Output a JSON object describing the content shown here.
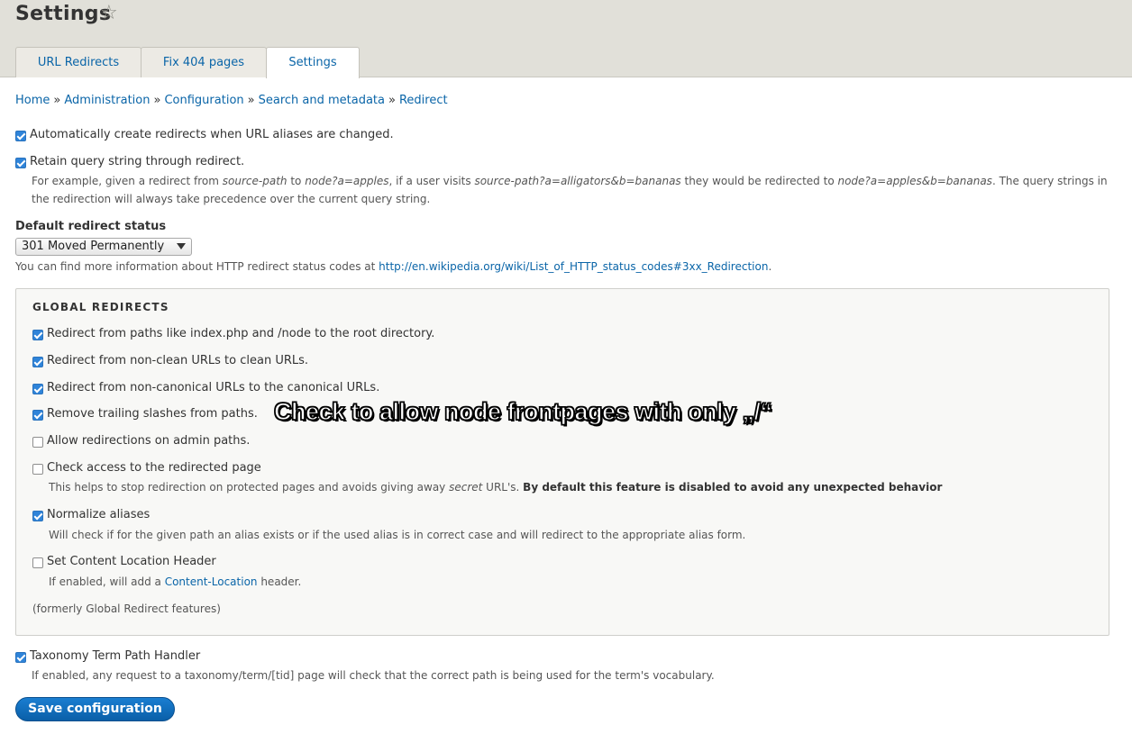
{
  "header": {
    "title": "Settings",
    "star_icon": "☆",
    "tabs": [
      {
        "label": "URL Redirects"
      },
      {
        "label": "Fix 404 pages"
      },
      {
        "label": "Settings"
      }
    ]
  },
  "breadcrumb": {
    "items": [
      "Home",
      "Administration",
      "Configuration",
      "Search and metadata",
      "Redirect"
    ],
    "separator": "»"
  },
  "options": {
    "auto_redirect": {
      "label": "Automatically create redirects when URL aliases are changed.",
      "checked": true
    },
    "retain_query": {
      "label": "Retain query string through redirect.",
      "checked": true,
      "desc": {
        "t1": "For example, given a redirect from ",
        "i1": "source-path",
        "t2": " to ",
        "i2": "node?a=apples",
        "t3": ", if a user visits ",
        "i3": "source-path?a=alligators&b=bananas",
        "t4": " they would be redirected to ",
        "i4": "node?a=apples&b=bananas",
        "t5": ". The query strings in",
        "line2": "the redirection will always take precedence over the current query string."
      }
    }
  },
  "status": {
    "label": "Default redirect status",
    "selected": "301 Moved Permanently",
    "help_prefix": "You can find more information about HTTP redirect status codes at ",
    "help_link": "http://en.wikipedia.org/wiki/List_of_HTTP_status_codes#3xx_Redirection",
    "help_suffix": "."
  },
  "global": {
    "legend": "GLOBAL REDIRECTS",
    "items": [
      {
        "label": "Redirect from paths like index.php and /node to the root directory.",
        "checked": true
      },
      {
        "label": "Redirect from non-clean URLs to clean URLs.",
        "checked": true
      },
      {
        "label": "Redirect from non-canonical URLs to the canonical URLs.",
        "checked": true
      },
      {
        "label": "Remove trailing slashes from paths.",
        "checked": true
      },
      {
        "label": "Allow redirections on admin paths.",
        "checked": false
      },
      {
        "label": "Check access to the redirected page",
        "checked": false
      },
      {
        "label": "Normalize aliases",
        "checked": true
      },
      {
        "label": "Set Content Location Header",
        "checked": false
      }
    ],
    "access_desc": {
      "t1": "This helps to stop redirection on protected pages and avoids giving away ",
      "i1": "secret",
      "t2": " URL's. ",
      "b1": "By default this feature is disabled to avoid any unexpected behavior"
    },
    "normalize_desc": "Will check if for the given path an alias exists or if the used alias is in correct case and will redirect to the appropriate alias form.",
    "content_location_desc": {
      "t1": "If enabled, will add a ",
      "link": "Content-Location",
      "t2": " header."
    },
    "footnote": "(formerly Global Redirect features)"
  },
  "annotation": "Check to allow node frontpages with only „/“",
  "taxonomy": {
    "label": "Taxonomy Term Path Handler",
    "checked": true,
    "desc": "If enabled, any request to a taxonomy/term/[tid] page will check that the correct path is being used for the term's vocabulary."
  },
  "save_label": "Save configuration",
  "colors": {
    "link": "#0a65a8",
    "checkbox": "#2f84d9",
    "button": "#0a5fa8",
    "header_bg": "#e1e0d9"
  }
}
